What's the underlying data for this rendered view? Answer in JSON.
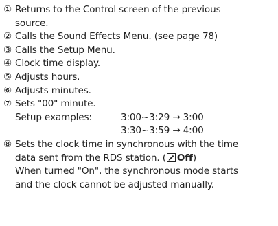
{
  "items": [
    {
      "number": "①",
      "lines": [
        "Returns to the Control screen of the previous",
        "source."
      ]
    },
    {
      "number": "②",
      "lines": [
        "Calls the Sound Effects Menu. (see page 78)"
      ]
    },
    {
      "number": "③",
      "lines": [
        "Calls the Setup Menu."
      ]
    },
    {
      "number": "④",
      "lines": [
        "Clock time display."
      ]
    },
    {
      "number": "⑤",
      "lines": [
        "Adjusts hours."
      ]
    },
    {
      "number": "⑥",
      "lines": [
        "Adjusts minutes."
      ]
    },
    {
      "number": "⑦",
      "lines": [
        "Sets \"00\" minute."
      ],
      "example_label": "Setup examples:",
      "examples": [
        "3:00~3:29 → 3:00",
        "3:30~3:59 → 4:00"
      ]
    },
    {
      "number": "⑧",
      "lines": [
        "Sets the clock time in synchronous with the time",
        "data sent from the RDS station. (",
        "When turned \"On\", the synchronous mode starts",
        "and the clock cannot be adjusted manually."
      ],
      "default_value": "Off",
      "default_close": ")",
      "default_icon": "pen-icon"
    }
  ]
}
